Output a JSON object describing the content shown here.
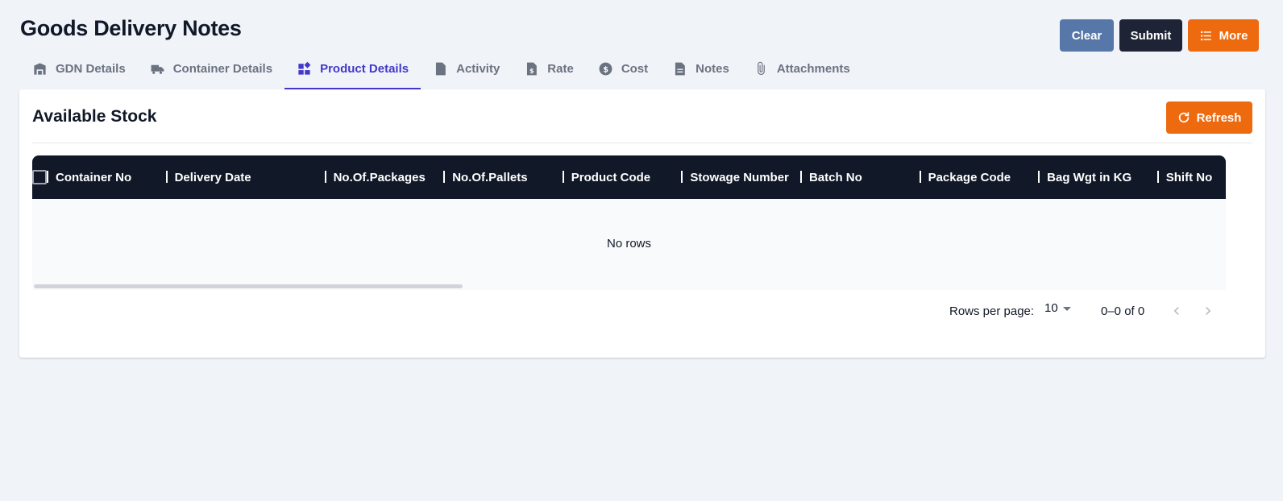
{
  "header": {
    "title": "Goods Delivery Notes",
    "actions": {
      "clear": "Clear",
      "submit": "Submit",
      "more": "More"
    }
  },
  "tabs": [
    {
      "label": "GDN Details",
      "icon": "warehouse-icon",
      "active": false
    },
    {
      "label": "Container Details",
      "icon": "truck-icon",
      "active": false
    },
    {
      "label": "Product Details",
      "icon": "widgets-icon",
      "active": true
    },
    {
      "label": "Activity",
      "icon": "file-activity-icon",
      "active": false
    },
    {
      "label": "Rate",
      "icon": "file-dollar-icon",
      "active": false
    },
    {
      "label": "Cost",
      "icon": "dollar-circle-icon",
      "active": false
    },
    {
      "label": "Notes",
      "icon": "document-icon",
      "active": false
    },
    {
      "label": "Attachments",
      "icon": "paperclip-icon",
      "active": false
    }
  ],
  "stock": {
    "title": "Available Stock",
    "refresh_label": "Refresh",
    "columns": [
      "Container No",
      "Delivery Date",
      "No.Of.Packages",
      "No.Of.Pallets",
      "Product Code",
      "Stowage Number",
      "Batch No",
      "Package Code",
      "Bag Wgt in KG",
      "Shift No"
    ],
    "rows": [],
    "empty_text": "No rows",
    "pagination": {
      "rows_per_page_label": "Rows per page:",
      "rows_per_page_value": "10",
      "range_text": "0–0 of 0"
    }
  },
  "colors": {
    "accent": "#4338ca",
    "orange": "#ee6a0e",
    "clear_button": "#5677a8",
    "submit_button": "#1e2435",
    "grid_header": "#111827"
  }
}
